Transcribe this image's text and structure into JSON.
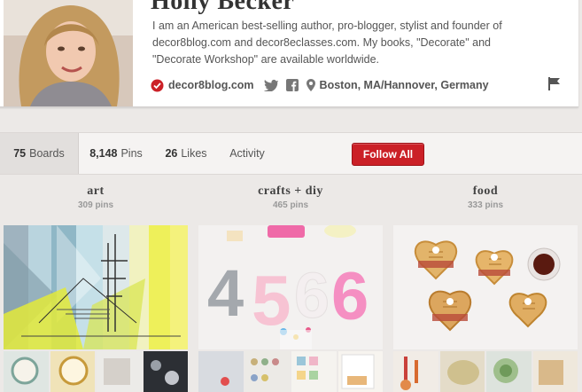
{
  "profile": {
    "name": "Holly Becker",
    "bio": "I am an American best-selling author, pro-blogger, stylist and founder of decor8blog.com and decor8eclasses.com. My books, \"Decorate\" and \"Decorate Workshop\" are available worldwide.",
    "website": "decor8blog.com",
    "location": "Boston, MA/Hannover, Germany",
    "icons": [
      "pinterest-badge-icon",
      "twitter-icon",
      "facebook-icon",
      "location-pin-icon",
      "flag-icon"
    ]
  },
  "tabs": [
    {
      "count": "75",
      "label": "Boards",
      "active": true
    },
    {
      "count": "8,148",
      "label": "Pins"
    },
    {
      "count": "26",
      "label": "Likes"
    },
    {
      "count": "",
      "label": "Activity"
    }
  ],
  "follow_all_label": "Follow All",
  "boards": [
    {
      "title": "art",
      "count": "309 pins"
    },
    {
      "title": "crafts + diy",
      "count": "465 pins"
    },
    {
      "title": "food",
      "count": "333 pins"
    }
  ],
  "colors": {
    "accent_red": "#cb2027",
    "page_bg": "#ece9e7"
  }
}
